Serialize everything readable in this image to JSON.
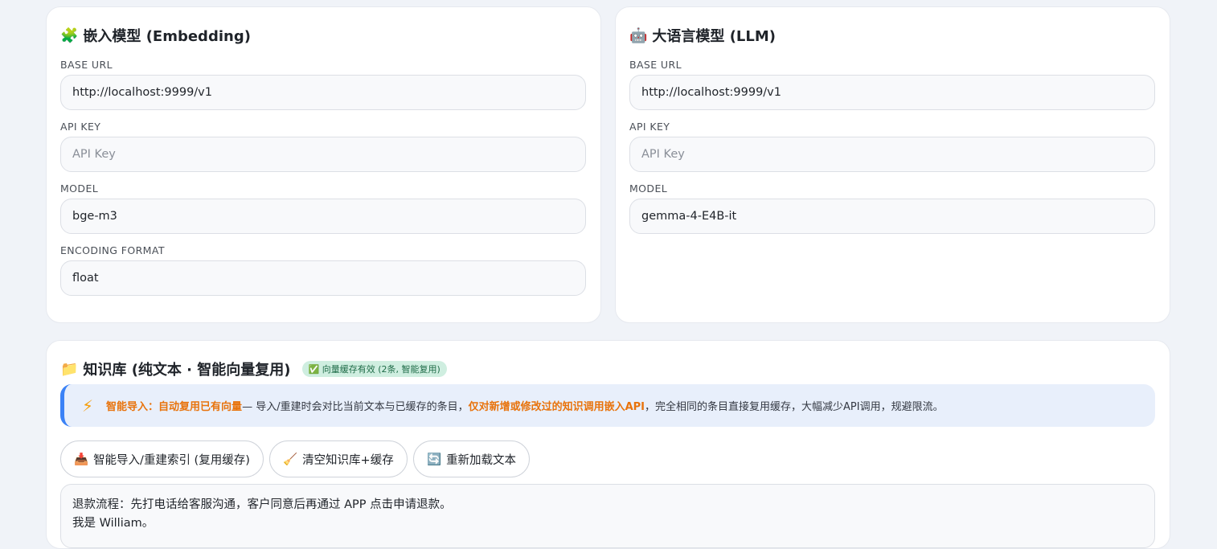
{
  "embedding": {
    "icon": "puzzle-icon",
    "icon_glyph": "🧩",
    "title": "嵌入模型 (Embedding)",
    "base_url_label": "BASE URL",
    "base_url_value": "http://localhost:9999/v1",
    "api_key_label": "API KEY",
    "api_key_placeholder": "API Key",
    "model_label": "MODEL",
    "model_value": "bge-m3",
    "encoding_label": "ENCODING FORMAT",
    "encoding_value": "float"
  },
  "llm": {
    "icon": "robot-icon",
    "icon_glyph": "🤖",
    "title": "大语言模型 (LLM)",
    "base_url_label": "BASE URL",
    "base_url_value": "http://localhost:9999/v1",
    "api_key_label": "API KEY",
    "api_key_placeholder": "API Key",
    "model_label": "MODEL",
    "model_value": "gemma-4-E4B-it"
  },
  "knowledge": {
    "icon": "folder-icon",
    "icon_glyph": "📁",
    "title": "知识库 (纯文本 · 智能向量复用)",
    "badge": "✅ 向量缓存有效 (2条, 智能复用)",
    "notice": {
      "icon": "lightning-icon",
      "icon_glyph": "⚡",
      "highlight1": "智能导入：自动复用已有向量",
      "text1": " — 导入/重建时会对比当前文本与已缓存的条目，",
      "highlight2": "仅对新增或修改过的知识调用嵌入API",
      "text2": "，完全相同的条目直接复用缓存，大幅减少API调用，规避限流。"
    },
    "buttons": [
      {
        "icon": "inbox-tray-icon",
        "glyph": "📥",
        "label": "智能导入/重建索引 (复用缓存)"
      },
      {
        "icon": "broom-icon",
        "glyph": "🧹",
        "label": "清空知识库+缓存"
      },
      {
        "icon": "reload-icon",
        "glyph": "🔄",
        "label": "重新加载文本"
      }
    ],
    "text_content": "退款流程：先打电话给客服沟通，客户同意后再通过 APP 点击申请退款。\n我是 William。"
  },
  "colors": {
    "page_bg": "#f0f3f8",
    "accent_blue": "#3b82f6",
    "highlight_orange": "#e8730c",
    "badge_bg": "#cfeee0"
  }
}
